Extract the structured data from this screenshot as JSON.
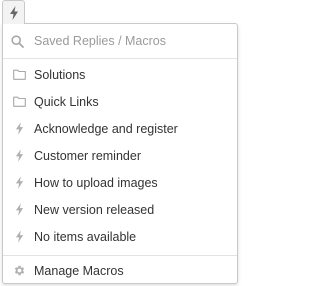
{
  "trigger": {
    "icon": "lightning-bolt-icon"
  },
  "search": {
    "placeholder": "Saved Replies / Macros",
    "value": "",
    "icon": "search-icon"
  },
  "items": [
    {
      "label": "Solutions",
      "icon": "folder-icon"
    },
    {
      "label": "Quick Links",
      "icon": "folder-icon"
    },
    {
      "label": "Acknowledge and register",
      "icon": "lightning-bolt-icon"
    },
    {
      "label": "Customer reminder",
      "icon": "lightning-bolt-icon"
    },
    {
      "label": "How to upload images",
      "icon": "lightning-bolt-icon"
    },
    {
      "label": "New version released",
      "icon": "lightning-bolt-icon"
    },
    {
      "label": "No items available",
      "icon": "lightning-bolt-icon"
    }
  ],
  "footer": {
    "label": "Manage Macros",
    "icon": "gear-icon"
  },
  "colors": {
    "icon_gray": "#a8a8a8",
    "trigger_icon": "#666666",
    "border": "#c9c9c9",
    "text": "#333333"
  }
}
